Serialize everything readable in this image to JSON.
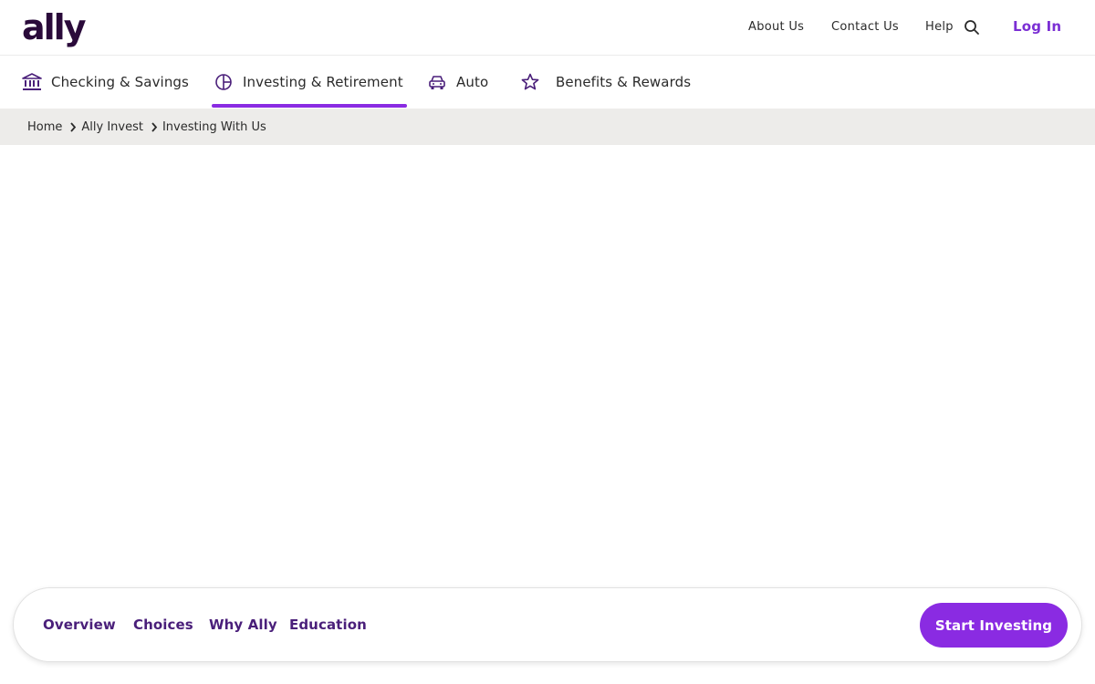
{
  "brand": {
    "logo_text": "ally",
    "accent_color": "#8a2be2",
    "dark_color": "#2a0a3a"
  },
  "header": {
    "links": [
      {
        "label": "About Us"
      },
      {
        "label": "Contact Us"
      },
      {
        "label": "Help"
      }
    ],
    "search_icon": "search-icon",
    "login_label": "Log In"
  },
  "main_nav": {
    "items": [
      {
        "label": "Checking & Savings",
        "icon": "bank-icon",
        "active": false
      },
      {
        "label": "Investing & Retirement",
        "icon": "pie-chart-icon",
        "active": true
      },
      {
        "label": "Auto",
        "icon": "car-icon",
        "active": false
      },
      {
        "label": "Benefits & Rewards",
        "icon": "star-icon",
        "active": false
      }
    ]
  },
  "breadcrumb": {
    "items": [
      {
        "label": "Home"
      },
      {
        "label": "Ally Invest"
      },
      {
        "label": "Investing With Us"
      }
    ]
  },
  "sub_nav": {
    "links": [
      {
        "label": "Overview"
      },
      {
        "label": "Choices"
      },
      {
        "label": "Why Ally"
      },
      {
        "label": "Education"
      }
    ],
    "cta_label": "Start Investing"
  }
}
